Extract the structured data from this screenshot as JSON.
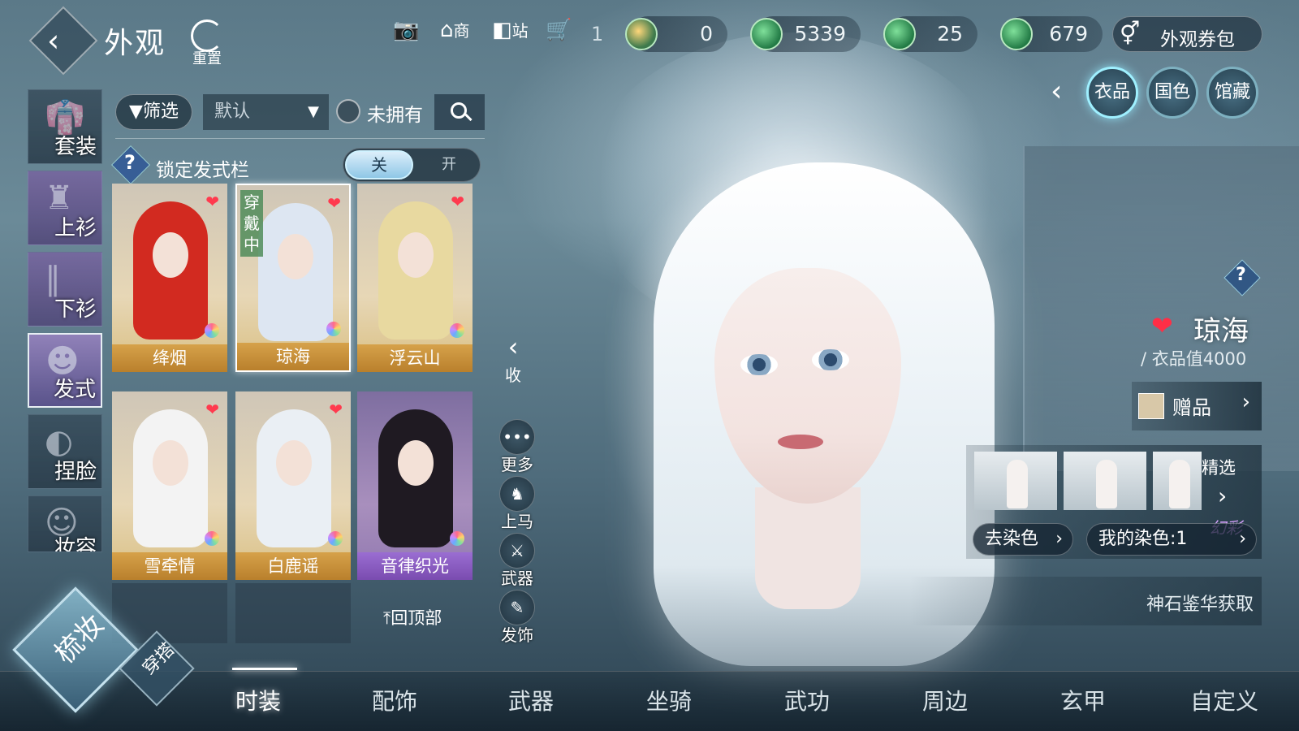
{
  "header": {
    "title": "外观",
    "reset_label": "重置",
    "tools": [
      {
        "icon": "camera-icon",
        "label": ""
      },
      {
        "icon": "shop-icon",
        "label": "商"
      },
      {
        "icon": "station-icon",
        "label": "站"
      }
    ],
    "cart_count": "1",
    "currencies": [
      "0",
      "5339",
      "25",
      "679"
    ],
    "voucher_label": "外观券包"
  },
  "right_tabs": [
    "衣品",
    "国色",
    "馆藏"
  ],
  "categories": [
    "套装",
    "上衫",
    "下衫",
    "发式",
    "捏脸",
    "妆容"
  ],
  "filter": {
    "filter_label": "筛选",
    "sort_value": "默认",
    "unowned_label": "未拥有"
  },
  "lock": {
    "label": "锁定发式栏",
    "off_label": "关",
    "on_label": "开"
  },
  "hairstyles": [
    {
      "name": "绛烟",
      "hair_color": "#d22a20",
      "favorite": true,
      "wearing": false
    },
    {
      "name": "琼海",
      "hair_color": "#dde6f2",
      "favorite": true,
      "wearing": true
    },
    {
      "name": "浮云山",
      "hair_color": "#e8d9a0",
      "favorite": true,
      "wearing": false
    },
    {
      "name": "雪牵情",
      "hair_color": "#f3f3f3",
      "favorite": true,
      "wearing": false
    },
    {
      "name": "白鹿谣",
      "hair_color": "#eaeff4",
      "favorite": true,
      "wearing": false
    },
    {
      "name": "音律织光",
      "hair_color": "#1f1a22",
      "favorite": false,
      "wearing": false
    }
  ],
  "wearing_label": "穿戴中",
  "back_to_top_label": "回顶部",
  "side_actions": {
    "collapse_label": "收",
    "more_label": "更多",
    "mount_label": "上马",
    "weapon_label": "武器",
    "hair_accessory_label": "发饰"
  },
  "item": {
    "name": "琼海",
    "value_label": "衣品值4000",
    "gift_label": "赠品",
    "featured_label": "精选",
    "iridescent_label": "幻彩",
    "dye_button": "去染色",
    "my_dye_button": "我的染色:1",
    "source_label": "神石鉴华获取"
  },
  "bottom_nav": {
    "main_label": "梳妆",
    "secondary_label": "穿搭",
    "items": [
      "时装",
      "配饰",
      "武器",
      "坐骑",
      "武功",
      "周边",
      "玄甲",
      "自定义"
    ]
  }
}
